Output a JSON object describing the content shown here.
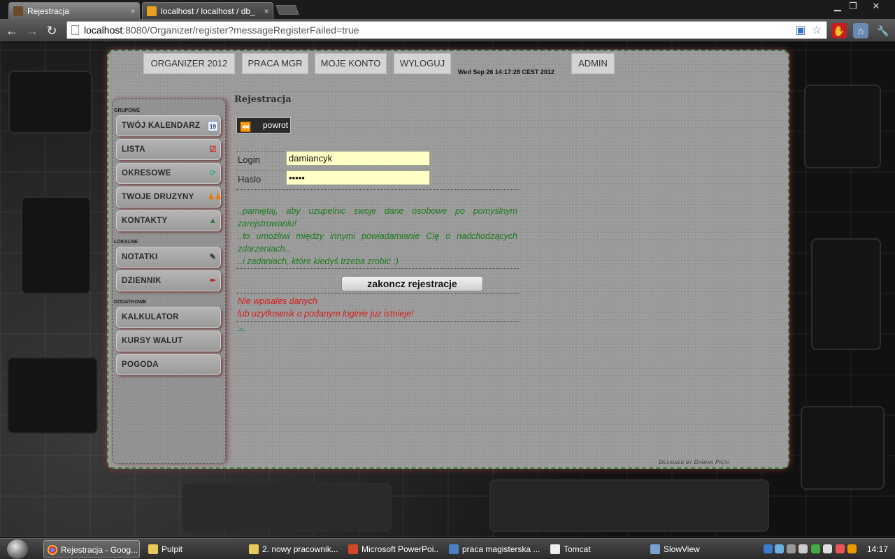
{
  "browser": {
    "tabs": [
      {
        "title": "Rejestracja",
        "close": "×"
      },
      {
        "title": "localhost / localhost / db_",
        "close": "×"
      }
    ],
    "window_controls": {
      "minimize": "▁",
      "maximize": "❐",
      "close": "✕"
    },
    "url_host": "localhost",
    "url_rest": ":8080/Organizer/register?messageRegisterFailed=true",
    "nav": {
      "back": "←",
      "forward": "→",
      "reload": "↻"
    }
  },
  "topnav": {
    "items": [
      "ORGANIZER 2012",
      "PRACA MGR",
      "MOJE KONTO",
      "WYLOGUJ",
      "ADMIN"
    ],
    "datetime": "Wed Sep 26 14:17:28 CEST 2012"
  },
  "sidebar": {
    "sections": [
      "GRUPOWE",
      "LOKALNE",
      "DODATKOWE"
    ],
    "items": [
      {
        "label": "TWÓJ KALENDARZ",
        "icon": "calendar-icon"
      },
      {
        "label": "LISTA",
        "icon": "checklist-icon"
      },
      {
        "label": "OKRESOWE",
        "icon": "recurring-icon"
      },
      {
        "label": "TWOJE DRUZYNY",
        "icon": "team-icon"
      },
      {
        "label": "KONTAKTY",
        "icon": "contacts-icon"
      },
      {
        "label": "NOTATKI",
        "icon": "notes-icon"
      },
      {
        "label": "DZIENNIK",
        "icon": "journal-icon"
      },
      {
        "label": "KALKULATOR",
        "icon": ""
      },
      {
        "label": "KURSY WALUT",
        "icon": ""
      },
      {
        "label": "POGODA",
        "icon": ""
      }
    ]
  },
  "content": {
    "title": "Rejestracja",
    "back_label": "powrot",
    "login_label": "Login",
    "login_value": "damiancyk",
    "password_label": "Haslo",
    "password_value": "•••••",
    "info_lines": [
      "..pamiętaj, aby uzupelnic swoje dane osobowe po pomyślnym zarejstrowaniu!",
      "..to umożliwi między innymi powiadamianie Cię o nadchodzących zdarzeniach..",
      "..i zadaniach, które kiedyś trzeba zrobić :)"
    ],
    "submit_label": "zakoncz rejestracje",
    "error_line1": "Nie wpisales danych",
    "error_line2": "lub uzytkownik o podanym loginie juz istnieje!",
    "tail": "-=-",
    "credit": "Designed by Damian Pięta"
  },
  "taskbar": {
    "tasks": [
      "Rejestracja - Goog...",
      "Pulpit",
      "2. nowy pracownik...",
      "Microsoft PowerPoi...",
      "praca magisterska ...",
      "Tomcat",
      "SlowView"
    ],
    "clock": "14:17"
  }
}
